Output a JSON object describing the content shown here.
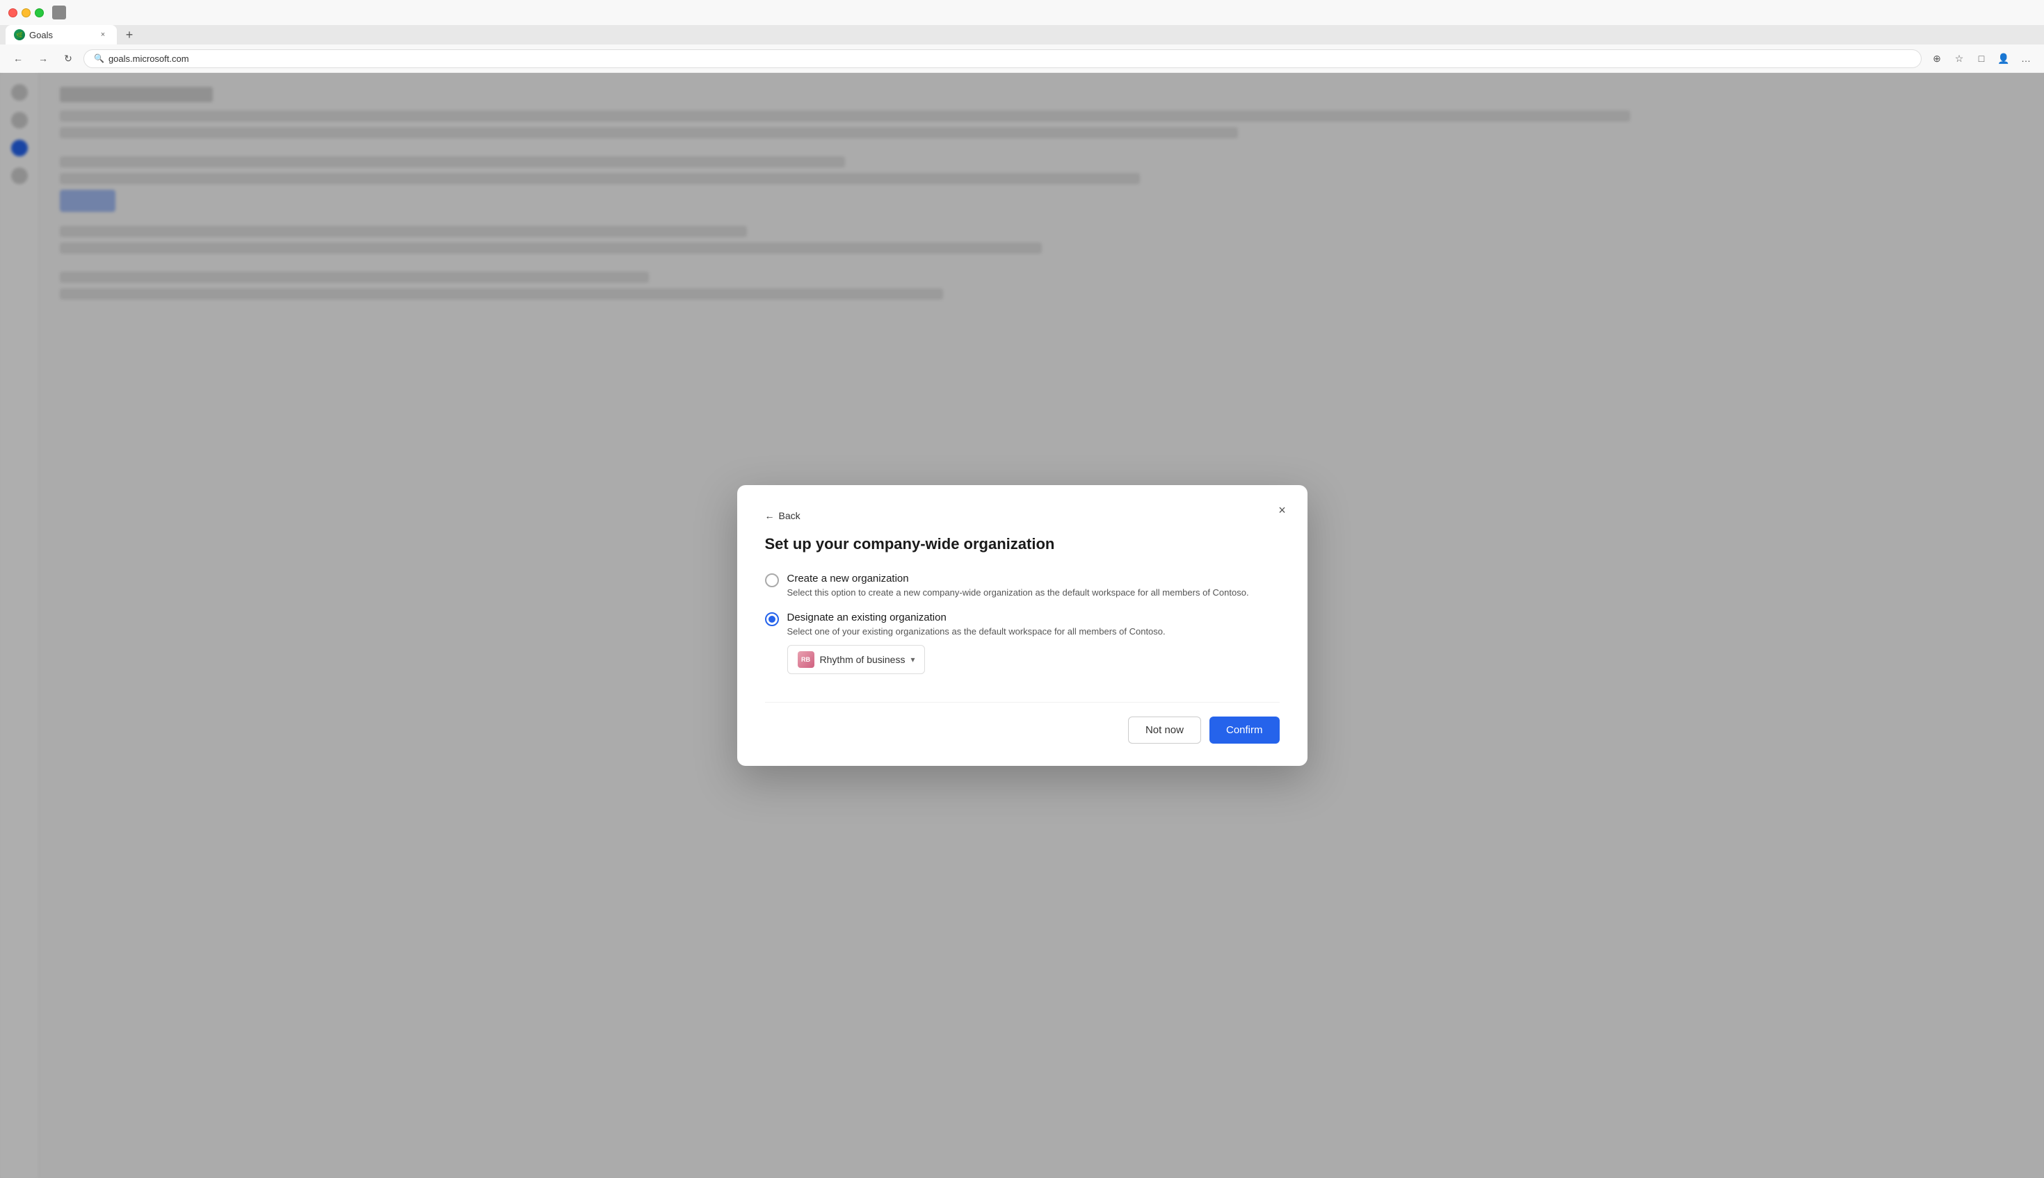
{
  "browser": {
    "tab_title": "Goals",
    "tab_favicon_letter": "G",
    "address_bar": "goals.microsoft.com",
    "close_label": "×",
    "new_tab_label": "+",
    "back_label": "←",
    "forward_label": "→",
    "refresh_label": "↻"
  },
  "modal": {
    "back_label": "Back",
    "close_label": "×",
    "title": "Set up your company-wide organization",
    "option1": {
      "title": "Create a new organization",
      "description": "Select this option to create a new company-wide organization as the default workspace for all members of Contoso.",
      "selected": false
    },
    "option2": {
      "title": "Designate an existing organization",
      "description": "Select one of your existing organizations as the default workspace for all members of Contoso.",
      "selected": true
    },
    "dropdown": {
      "avatar_letters": "RB",
      "label": "Rhythm of business"
    },
    "footer": {
      "not_now_label": "Not now",
      "confirm_label": "Confirm"
    }
  }
}
